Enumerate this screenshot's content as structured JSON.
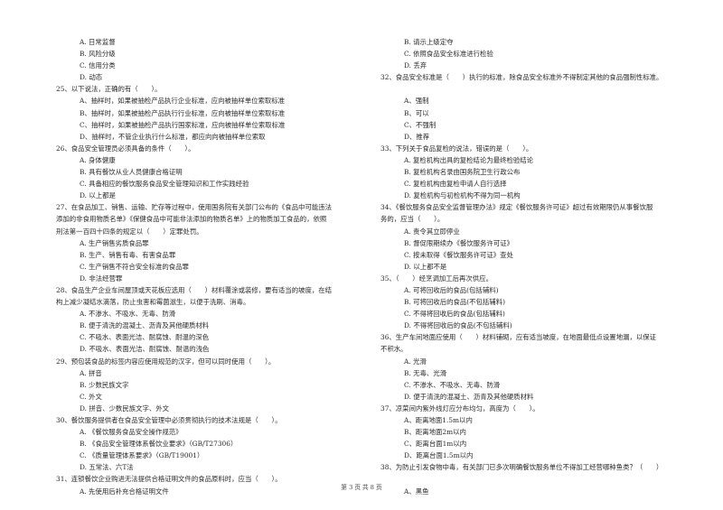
{
  "left_column": [
    {
      "type": "opt",
      "text": "A. 日常监督"
    },
    {
      "type": "opt",
      "text": "B. 风险分级"
    },
    {
      "type": "opt",
      "text": "C. 信用分类"
    },
    {
      "type": "opt",
      "text": "D. 动态"
    },
    {
      "type": "q",
      "text": "25、以下说法，正确的有（　　）。"
    },
    {
      "type": "opt",
      "text": "A、抽样时，如果被抽检产品执行企业标准，应向被抽样单位索取标准"
    },
    {
      "type": "opt",
      "text": "B、抽样时，如果被抽检产品执行行业标准，应向被抽样单位索取标准"
    },
    {
      "type": "opt",
      "text": "C、抽样时，如果被抽检产品执行国家标准，应向被抽样单位索取标准"
    },
    {
      "type": "opt",
      "text": "D、抽样时，不管企业执行什么标准，都应向向被抽样单位索取"
    },
    {
      "type": "q",
      "text": "26、食品安全管理员必须具备的条件（　　）。"
    },
    {
      "type": "opt",
      "text": "A. 身体健康"
    },
    {
      "type": "opt",
      "text": "B. 具有餐饮从业人员健康合格证明"
    },
    {
      "type": "opt",
      "text": "C. 具备相应的餐饮服务食品安全管理知识和工作实践经验"
    },
    {
      "type": "opt",
      "text": "D. 以上都是"
    },
    {
      "type": "q",
      "text": "27、在食品加工、销售、运输、贮存等过程中，使用国务院有关部门公布的《食品中可能违法"
    },
    {
      "type": "q",
      "text": "添加的非食用物质名单》《保健食品中可能非法添加的物质名单》上的物质加工食品的，依照"
    },
    {
      "type": "q",
      "text": "刑法第一百四十四条的规定以（　　）定罪处罚。"
    },
    {
      "type": "opt",
      "text": "A. 生产销售劣质食品罪"
    },
    {
      "type": "opt",
      "text": "B. 生产、销售有毒、有害食品罪"
    },
    {
      "type": "opt",
      "text": "C. 生产销售不符合安全标准的食品罪"
    },
    {
      "type": "opt",
      "text": "D. 非法经营罪"
    },
    {
      "type": "q",
      "text": "28、食品生产企业车间屋顶或天花板应选用（　　）材料覆涂或装修，要有适当的坡度，在结"
    },
    {
      "type": "q",
      "text": "构上减少凝结水滴落，防止虫害和霉菌滋生，以便于洗刷、消毒。"
    },
    {
      "type": "opt",
      "text": "A. 不渗水、不吸水、无毒、防滑"
    },
    {
      "type": "opt",
      "text": "B. 便于清洗的混凝土、沥青及其他硬质材料"
    },
    {
      "type": "opt",
      "text": "C. 不吸水、表面光洁、耐腐蚀、耐温的深色"
    },
    {
      "type": "opt",
      "text": "D. 不吸水、表面光洁、耐腐蚀、耐温的浅色"
    },
    {
      "type": "q",
      "text": "29、预包装食品的标签内容应使用规范的汉字，但可以同时使用（　　）。"
    },
    {
      "type": "opt",
      "text": "A. 拼音"
    },
    {
      "type": "opt",
      "text": "B. 少数民族文字"
    },
    {
      "type": "opt",
      "text": "C. 外文"
    },
    {
      "type": "opt",
      "text": "D. 拼音、少数民族文字、外文"
    },
    {
      "type": "q",
      "text": "30、餐饮服务提供者在食品安全管理中必须贯彻执行的技术法规是（　　）。"
    },
    {
      "type": "opt",
      "text": "A. 《餐饮服务食品安全操作规范》"
    },
    {
      "type": "opt",
      "text": "B. 《食品安全管理体系餐饮业要求》（GB/T27306）"
    },
    {
      "type": "opt",
      "text": "C. 《质量管理体系要求》（GB/T19001）"
    },
    {
      "type": "opt",
      "text": "D. 五常法、六T法"
    },
    {
      "type": "q",
      "text": "31、连锁餐饮企业购进无法提供合格证明文件的食品原料时，应当（　　）。"
    },
    {
      "type": "opt",
      "text": "A. 先使用后补充合格证明文件"
    }
  ],
  "right_column": [
    {
      "type": "opt",
      "text": "B. 请示上级定夺"
    },
    {
      "type": "opt",
      "text": "C. 依照食品安全标准进行检验"
    },
    {
      "type": "opt",
      "text": "D. 丢弃"
    },
    {
      "type": "q",
      "text": "32、食品安全标准是（　　）执行的标准，除食品安全标准外不得制定其他的食品强制性标准。"
    },
    {
      "type": "spacer",
      "text": ""
    },
    {
      "type": "opt",
      "text": "A、强制"
    },
    {
      "type": "opt",
      "text": "B、可以"
    },
    {
      "type": "opt",
      "text": "C、不强制"
    },
    {
      "type": "opt",
      "text": "D、推荐"
    },
    {
      "type": "q",
      "text": "33、下列关于食品复检的说法，错误的是（　　）。"
    },
    {
      "type": "opt",
      "text": "A. 复检机构出具的复检结论为最终检验结论"
    },
    {
      "type": "opt",
      "text": "B. 复检机构名录由国务院卫生行政公布"
    },
    {
      "type": "opt",
      "text": "C. 复检机构由复检申请人自行选择"
    },
    {
      "type": "opt",
      "text": "D. 复检机构与初检机构不得为同一机构"
    },
    {
      "type": "q",
      "text": "34、《餐饮服务食品安全监督管理办法》规定《餐饮服务许可证》超过有效期限仍从事餐饮服"
    },
    {
      "type": "q",
      "text": "务的，应当（　　）。"
    },
    {
      "type": "opt",
      "text": "A. 责令其立即停业"
    },
    {
      "type": "opt",
      "text": "B. 督促限期续办《餐饮服务许可证》"
    },
    {
      "type": "opt",
      "text": "C. 按未取得《餐饮服务许可证》查处"
    },
    {
      "type": "opt",
      "text": "D. 以上都不是"
    },
    {
      "type": "q",
      "text": "35、（　　）经烹调加工后再次供应。"
    },
    {
      "type": "opt",
      "text": "A. 可将回收后的食品(包括辅料)"
    },
    {
      "type": "opt",
      "text": "B. 可将回收后的食品(不包括辅料)"
    },
    {
      "type": "opt",
      "text": "C. 不得将回收后的食品(包括辅料)"
    },
    {
      "type": "opt",
      "text": "D. 不得将回收后的食品(不包括辅料)"
    },
    {
      "type": "q",
      "text": "36、生产车间地面应使用（　　）材料铺砌，应有适当坡度，在地面最低点设置地漏，以保证"
    },
    {
      "type": "q",
      "text": "不积水。"
    },
    {
      "type": "opt",
      "text": "A. 光滑"
    },
    {
      "type": "opt",
      "text": "B. 无毒、光滑"
    },
    {
      "type": "opt",
      "text": "C. 不渗水、不吸水、无毒、防滑"
    },
    {
      "type": "opt",
      "text": "D. 便于清洗的混凝土、沥青及其他硬质材料"
    },
    {
      "type": "q",
      "text": "37、凉菜间内紫外线灯应分布均匀，高度为（　　）。"
    },
    {
      "type": "opt",
      "text": "A、距离地面1.5m以内"
    },
    {
      "type": "opt",
      "text": "B、距离地面2m以内"
    },
    {
      "type": "opt",
      "text": "C、距离台面1m以内"
    },
    {
      "type": "opt",
      "text": "D、距离台面1.5m以内"
    },
    {
      "type": "q",
      "text": "38、为防止引发食物中毒，有关部门已多次明确餐饮服务单位不得加工经营哪种鱼类？（　　）"
    },
    {
      "type": "spacer",
      "text": ""
    },
    {
      "type": "opt",
      "text": "A、黑鱼"
    }
  ],
  "footer": {
    "page_label": "第 3 页 共 8 页"
  }
}
